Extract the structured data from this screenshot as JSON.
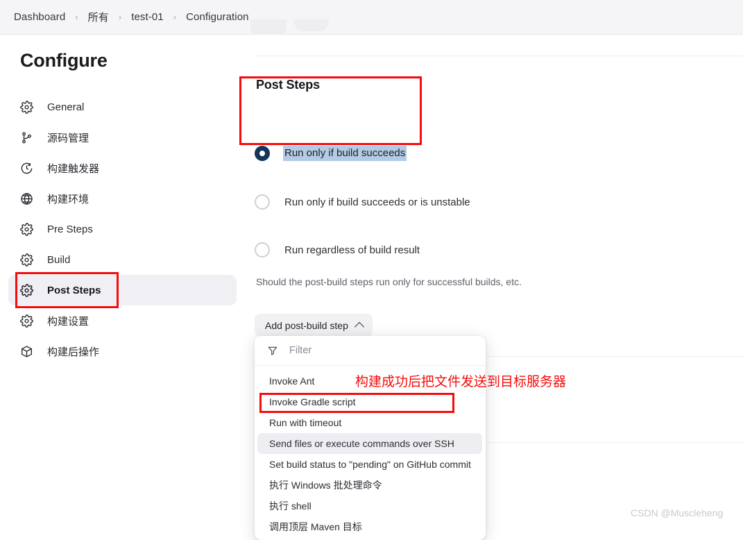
{
  "breadcrumb": {
    "separator": "›",
    "items": [
      "Dashboard",
      "所有",
      "test-01",
      "Configuration"
    ]
  },
  "sidebar": {
    "title": "Configure",
    "items": [
      {
        "label": "General",
        "icon": "gear-icon",
        "selected": false
      },
      {
        "label": "源码管理",
        "icon": "branch-icon",
        "selected": false
      },
      {
        "label": "构建触发器",
        "icon": "clock-icon",
        "selected": false
      },
      {
        "label": "构建环境",
        "icon": "globe-icon",
        "selected": false
      },
      {
        "label": "Pre Steps",
        "icon": "gear-icon",
        "selected": false
      },
      {
        "label": "Build",
        "icon": "gear-icon",
        "selected": false
      },
      {
        "label": "Post Steps",
        "icon": "gear-icon",
        "selected": true
      },
      {
        "label": "构建设置",
        "icon": "gear-icon",
        "selected": false
      },
      {
        "label": "构建后操作",
        "icon": "package-icon",
        "selected": false
      }
    ]
  },
  "main": {
    "section_title": "Post Steps",
    "radio_options": [
      {
        "label": "Run only if build succeeds",
        "checked": true,
        "text_selected": true
      },
      {
        "label": "Run only if build succeeds or is unstable",
        "checked": false,
        "text_selected": false
      },
      {
        "label": "Run regardless of build result",
        "checked": false,
        "text_selected": false
      }
    ],
    "helper_text": "Should the post-build steps run only for successful builds, etc.",
    "add_button": {
      "label": "Add post-build step",
      "icon": "chevron-up-icon"
    },
    "dropdown": {
      "filter": {
        "icon": "filter-funnel-icon",
        "placeholder": "Filter",
        "value": ""
      },
      "items": [
        {
          "label": "Invoke Ant",
          "hover": false
        },
        {
          "label": "Invoke Gradle script",
          "hover": false
        },
        {
          "label": "Run with timeout",
          "hover": false
        },
        {
          "label": "Send files or execute commands over SSH",
          "hover": true
        },
        {
          "label": "Set build status to \"pending\" on GitHub commit",
          "hover": false
        },
        {
          "label": "执行 Windows 批处理命令",
          "hover": false
        },
        {
          "label": "执行 shell",
          "hover": false
        },
        {
          "label": "调用顶层 Maven 目标",
          "hover": false
        }
      ]
    }
  },
  "annotations": {
    "note_text": "构建成功后把文件发送到目标服务器",
    "highlight_color": "#f50c0c",
    "boxes": [
      "sidebar-post-steps",
      "post-steps-section",
      "send-files-ssh-item"
    ]
  },
  "watermark": "CSDN @Muscleheng",
  "colors": {
    "accent_radio": "#143558",
    "text_selection": "#b3cbe4",
    "annotation_red": "#f50c0c",
    "topbar_bg": "#f5f5f7",
    "selected_nav_bg": "#f0f0f4"
  }
}
